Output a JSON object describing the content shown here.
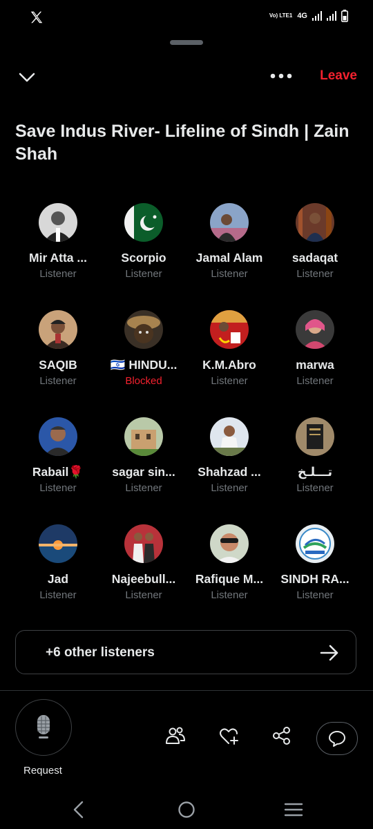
{
  "status_bar": {
    "app_icon": "x-logo-icon",
    "network_label": "4G",
    "volte_label": "Vo) LTE1",
    "signal_icons": [
      "signal-icon",
      "signal-icon"
    ],
    "battery_icon": "battery-icon"
  },
  "top_bar": {
    "collapse_icon": "chevron-down-icon",
    "more_icon": "more-options-icon",
    "leave_label": "Leave"
  },
  "space": {
    "title": "Save Indus River- Lifeline of Sindh | Zain Shah"
  },
  "participants": [
    {
      "name": "Mir Atta ...",
      "role": "Listener"
    },
    {
      "name": "Scorpio",
      "role": "Listener"
    },
    {
      "name": "Jamal Alam",
      "role": "Listener"
    },
    {
      "name": "sadaqat",
      "role": "Listener"
    },
    {
      "name": "SAQIB",
      "role": "Listener"
    },
    {
      "name": "🇮🇱 HINDU...",
      "role": "Blocked"
    },
    {
      "name": "K.M.Abro",
      "role": "Listener"
    },
    {
      "name": "marwa",
      "role": "Listener"
    },
    {
      "name": "Rabail🌹",
      "role": "Listener"
    },
    {
      "name": "sagar sin...",
      "role": "Listener"
    },
    {
      "name": "Shahzad ...",
      "role": "Listener"
    },
    {
      "name": "تـــلـخ",
      "role": "Listener"
    },
    {
      "name": "Jad",
      "role": "Listener"
    },
    {
      "name": "Najeebull...",
      "role": "Listener"
    },
    {
      "name": "Rafique M...",
      "role": "Listener"
    },
    {
      "name": "SINDH RA...",
      "role": "Listener"
    }
  ],
  "other_listeners": {
    "label": "+6 other listeners",
    "icon": "arrow-right-icon"
  },
  "bottom_bar": {
    "request_label": "Request",
    "mic_icon": "microphone-icon",
    "actions": [
      "people-icon",
      "heart-add-icon",
      "share-icon",
      "chat-bubble-icon"
    ]
  },
  "colors": {
    "background": "#000000",
    "text": "#e7e9ea",
    "secondary_text": "#71767b",
    "danger": "#f4212e",
    "border": "#3e4144"
  }
}
